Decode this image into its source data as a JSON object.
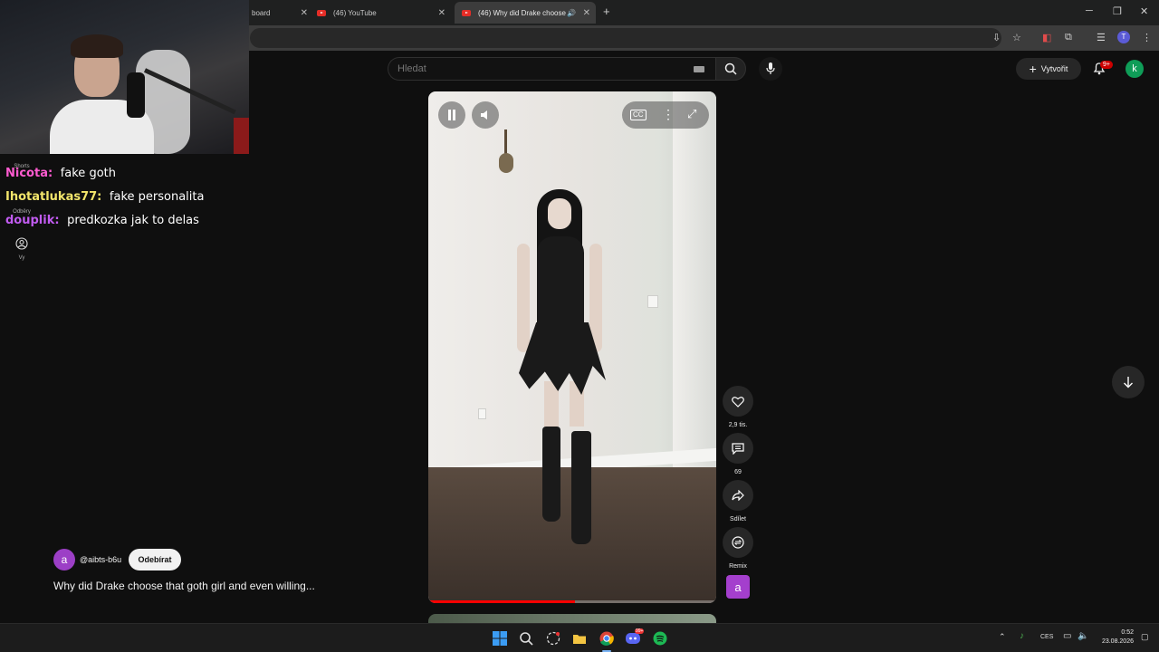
{
  "browser": {
    "tabs": [
      {
        "label": "board"
      },
      {
        "label": "(46) YouTube"
      },
      {
        "label": "(46) Why did Drake choose"
      }
    ],
    "new_tab_symbol": "+"
  },
  "youtube_header": {
    "search_placeholder": "Hledat",
    "create_label": "Vytvořit",
    "notifications_badge": "9+",
    "account_initial": "k"
  },
  "chat": [
    {
      "user": "Nicota:",
      "message": "fake goth",
      "color": "#ff5bd0"
    },
    {
      "user": "Ihotatlukas77:",
      "message": "fake personalita",
      "color": "#f2e56b"
    },
    {
      "user": "douplik:",
      "message": "predkozka jak to delas",
      "color": "#c15bf0"
    }
  ],
  "left_nav": {
    "shorts": "Shorts",
    "subscriptions": "Odběry",
    "you": "Vy"
  },
  "short": {
    "channel_initial": "a",
    "channel_handle": "@aibts-b6u",
    "subscribe_label": "Odebírat",
    "title": "Why did Drake choose that goth girl and even willing...",
    "progress": 0.51
  },
  "actions": {
    "likes": "2,9 tis.",
    "comments": "69",
    "share": "Sdílet",
    "remix": "Remix"
  },
  "taskbar": {
    "language": "CES",
    "time": "0:52",
    "date": "23.08.2026",
    "discord_badge": "99+"
  },
  "colors": {
    "accent_red": "#ff0000",
    "background": "#0f0f0f"
  }
}
